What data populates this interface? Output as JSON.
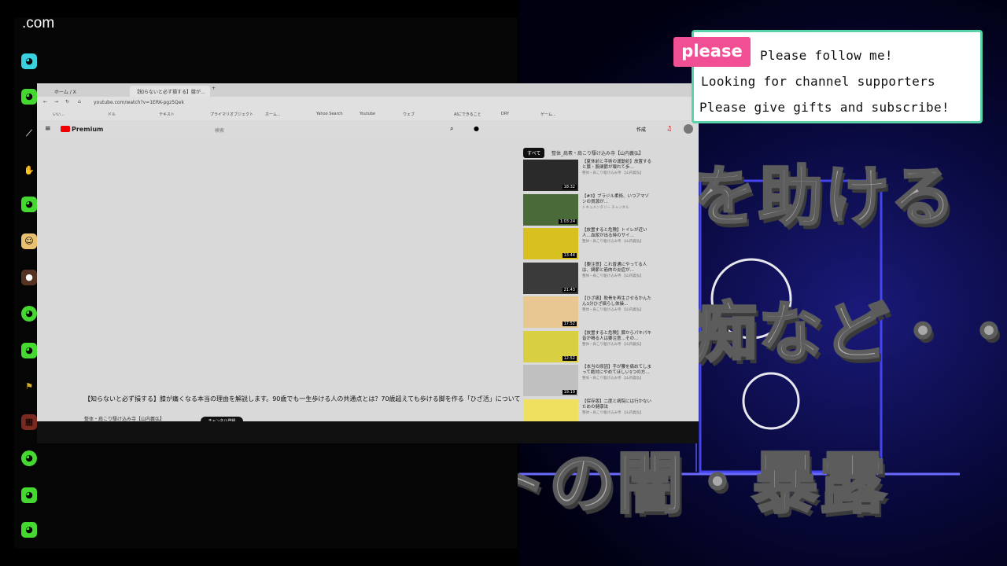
{
  "overlay": {
    "site_label": ".com",
    "sticker": {
      "tag": "please",
      "line1": "Please follow me!",
      "line2": "Looking for channel supporters",
      "line3": "Please give gifts and subscribe!"
    },
    "banner": {
      "top_text": "を助ける",
      "middle_text": "痴など・・・",
      "bottom_text": "ネットの闇・暴露"
    },
    "chat_icons": [
      "chat-avatar-green",
      "chat-avatar-green",
      "chat-avatar-broom",
      "chat-avatar-white",
      "chat-avatar-green",
      "chat-avatar-anime",
      "chat-avatar-person",
      "chat-avatar-green",
      "chat-avatar-green",
      "chat-avatar-yellow",
      "chat-avatar-red",
      "chat-avatar-green",
      "chat-avatar-green",
      "chat-avatar-green"
    ]
  },
  "browser": {
    "tabs": [
      "ホーム / X",
      "【知らないと必ず損する】膝が..."
    ],
    "url": "youtube.com/watch?v=1ERK-pgz5Qek",
    "bookmarks": [
      "いい...",
      "ドル",
      "テキスト",
      "プライマリオブジェクト",
      "ホーム...",
      "Yahoo Search",
      "Youtube",
      "ウェブ",
      "AIにできること",
      "DRY",
      "ゲーム..."
    ],
    "yt": {
      "logo": "Premium",
      "search_placeholder": "検索",
      "create_label": "作成",
      "video_title": "【知らないと必ず損する】膝が痛くなる本当の理由を解説します。90歳でも一生歩ける人の共通点とは？70歳超えても歩ける脚を作る「ひざ活」について",
      "channel": "整体・肩こり駆け込み寺【山内義弘】",
      "subscribe": "チャンネル登録",
      "chips": [
        "すべて",
        "整体_肩素・肩こり駆け込み寺【山内義弘】"
      ],
      "recommendations": [
        {
          "title": "【夏休前と手術の運動処】放置すると膝・股関節が壊れて歩…",
          "meta": "整体・肩こり駆け込み寺 【山内義弘】",
          "duration": "18:32",
          "color": "#2a2a2a"
        },
        {
          "title": "【#3】ブラジル柔術、いつアマゾンの資源が…",
          "meta": "ドキュメンタリー チャンネル",
          "duration": "1:03:24",
          "color": "#4a6a3a"
        },
        {
          "title": "【放置すると危険】トイレが近い人…血尿が出る時のサイ…",
          "meta": "整体・肩こり駆け込み寺 【山内義弘】",
          "duration": "13:44",
          "color": "#d8c020"
        },
        {
          "title": "【要注意】これ普通にやってる人は、関節と筋肉の炎症が…",
          "meta": "整体・肩こり駆け込み寺 【山内義弘】",
          "duration": "21:43",
          "color": "#3a3a3a"
        },
        {
          "title": "【ひざ痛】軟骨を再生させるかんたん1分ひざ揺らし体操…",
          "meta": "整体・肩こり駆け込み寺 【山内義弘】",
          "duration": "17:52",
          "color": "#e8c890"
        },
        {
          "title": "【放置すると危険】膝からパキパキ音が鳴る人は要注意…その…",
          "meta": "整体・肩こり駆け込み寺 【山内義弘】",
          "duration": "12:52",
          "color": "#d8d040"
        },
        {
          "title": "【本当の原因】手が腰を痛めてしまって絶対にやめてほしい1つの方…",
          "meta": "整体・肩こり駆け込み寺 【山内義弘】",
          "duration": "19:19",
          "color": "#c0c0c0"
        },
        {
          "title": "【保存版】二度と病院には行かないための健康法",
          "meta": "整体・肩こり駆け込み寺 【山内義弘】",
          "duration": "14:08",
          "color": "#f0e060"
        }
      ]
    }
  }
}
